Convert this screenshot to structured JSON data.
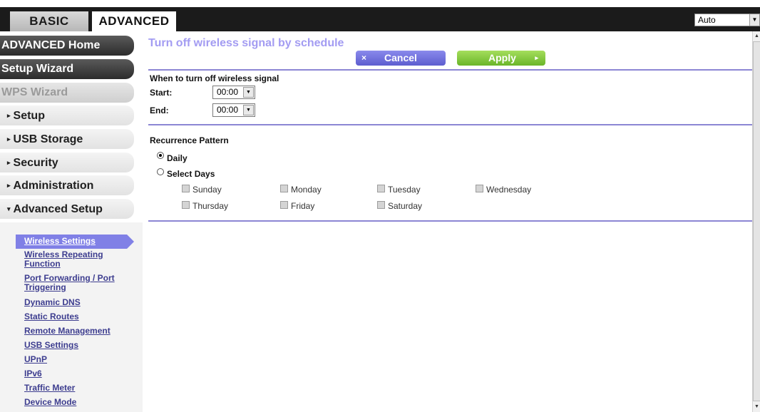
{
  "tabs": {
    "basic": "BASIC",
    "advanced": "ADVANCED"
  },
  "language": {
    "selected": "Auto"
  },
  "sidebar": {
    "main_items": [
      {
        "label": "ADVANCED Home"
      },
      {
        "label": "Setup Wizard"
      },
      {
        "label": "WPS Wizard"
      },
      {
        "label": "Setup"
      },
      {
        "label": "USB Storage"
      },
      {
        "label": "Security"
      },
      {
        "label": "Administration"
      },
      {
        "label": "Advanced Setup"
      }
    ],
    "caret_right": "▸",
    "caret_down": "▾",
    "sub_items": [
      {
        "label": "Wireless Settings"
      },
      {
        "label": "Wireless Repeating Function"
      },
      {
        "label": "Port Forwarding / Port Triggering"
      },
      {
        "label": "Dynamic DNS"
      },
      {
        "label": "Static Routes"
      },
      {
        "label": "Remote Management"
      },
      {
        "label": "USB Settings"
      },
      {
        "label": "UPnP"
      },
      {
        "label": "IPv6"
      },
      {
        "label": "Traffic Meter"
      },
      {
        "label": "Device Mode"
      }
    ]
  },
  "main": {
    "title": "Turn off wireless signal by schedule",
    "cancel_label": "Cancel",
    "apply_label": "Apply",
    "cancel_icon": "×",
    "apply_icon": "▸",
    "section1": {
      "heading": "When to turn off wireless signal",
      "start_label": "Start:",
      "start_value": "00:00",
      "end_label": "End:",
      "end_value": "00:00"
    },
    "section2": {
      "heading": "Recurrence Pattern",
      "daily_label": "Daily",
      "select_days_label": "Select Days",
      "days": [
        "Sunday",
        "Monday",
        "Tuesday",
        "Wednesday",
        "Thursday",
        "Friday",
        "Saturday"
      ]
    }
  },
  "colors": {
    "accent": "#8c86d4",
    "title": "#a39cf2",
    "apply_green": "#6ab52a",
    "cancel_purple": "#6d6dd8"
  }
}
